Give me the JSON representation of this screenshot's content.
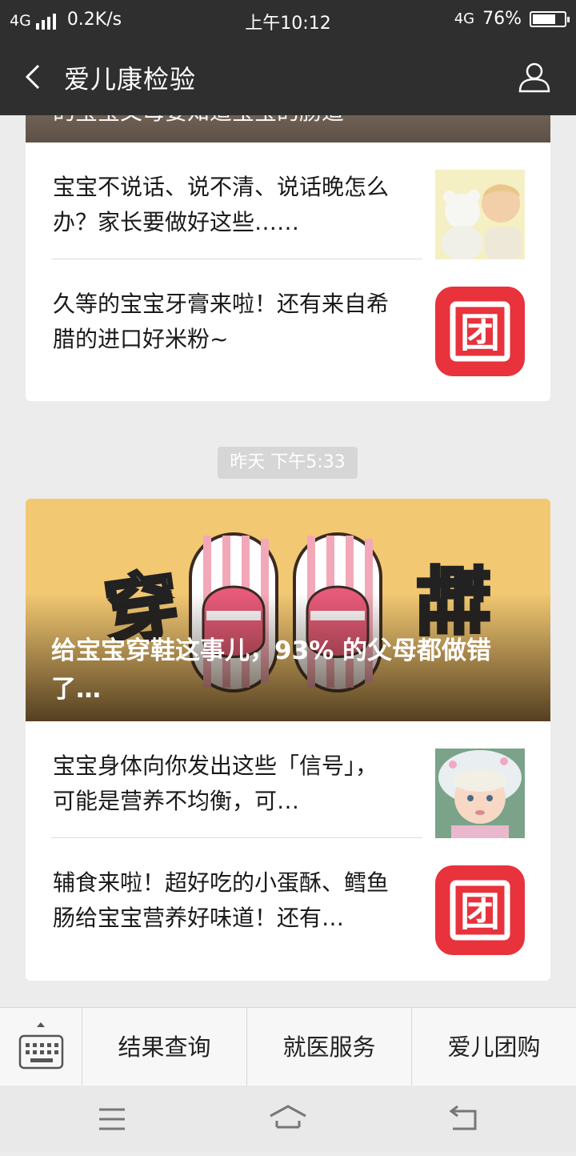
{
  "status_bar": {
    "network": "4G",
    "speed": "0.2K/s",
    "time": "上午10:12",
    "network_right": "4G",
    "battery": "76%",
    "battery_level": 0.76
  },
  "nav": {
    "title": "爱儿康检验",
    "back_icon": "chevron-left-icon",
    "profile_icon": "user-icon"
  },
  "feed": {
    "message1": {
      "cover_title_partial": "的宝宝父母要知道宝宝的肠道",
      "items": [
        {
          "title": "宝宝不说话、说不清、说话晚怎么办？家长要做好这些……",
          "thumb": "baby-with-bear-photo"
        },
        {
          "title": "久等的宝宝牙膏来啦！还有来自希腊的进口好米粉~",
          "thumb": "tuan-logo"
        }
      ]
    },
    "timestamp": "昨天 下午5:33",
    "message2": {
      "cover_title": "给宝宝穿鞋这事儿，93% 的父母都做错了…",
      "cover_art_text": [
        "穿",
        "鞋"
      ],
      "items": [
        {
          "title": "宝宝身体向你发出这些「信号」，可能是营养不均衡，可…",
          "thumb": "toddler-girl-photo"
        },
        {
          "title": "辅食来啦！超好吃的小蛋酥、鳕鱼肠给宝宝营养好味道！还有…",
          "thumb": "tuan-logo"
        }
      ]
    }
  },
  "menu": {
    "keyboard_icon": "keyboard-icon",
    "buttons": [
      "结果查询",
      "就医服务",
      "爱儿团购"
    ]
  },
  "tuan_logo_char": "团",
  "colors": {
    "header": "#2f2f2f",
    "tuan_red": "#e8323c",
    "cover_bg": "#f2c872"
  }
}
